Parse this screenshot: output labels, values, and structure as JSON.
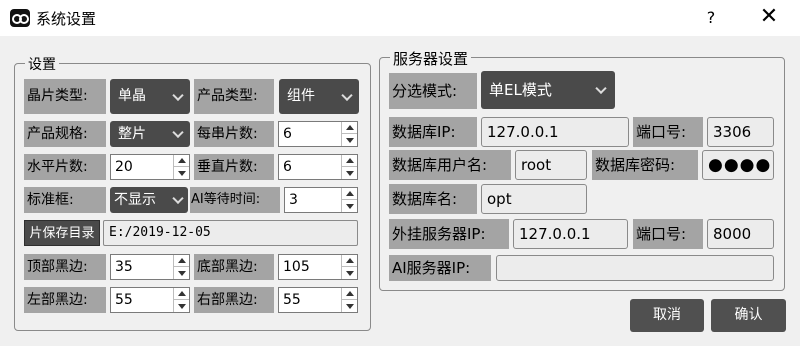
{
  "window": {
    "title": "系统设置",
    "help": "?",
    "close": "✕"
  },
  "settings": {
    "group_title": "设置",
    "wafer_type_label": "晶片类型:",
    "wafer_type_value": "单晶",
    "product_type_label": "产品类型:",
    "product_type_value": "组件",
    "product_spec_label": "产品规格:",
    "product_spec_value": "整片",
    "per_string_label": "每串片数:",
    "per_string_value": "6",
    "horizontal_label": "水平片数:",
    "horizontal_value": "20",
    "vertical_label": "垂直片数:",
    "vertical_value": "6",
    "frame_label": "标准框:",
    "frame_value": "不显示",
    "ai_wait_label": "AI等待时间:",
    "ai_wait_value": "3",
    "save_dir_button": "片保存目录",
    "save_dir_value": "E:/2019-12-05",
    "top_black_label": "顶部黑边:",
    "top_black_value": "35",
    "bottom_black_label": "底部黑边:",
    "bottom_black_value": "105",
    "left_black_label": "左部黑边:",
    "left_black_value": "55",
    "right_black_label": "右部黑边:",
    "right_black_value": "55"
  },
  "server": {
    "group_title": "服务器设置",
    "mode_label": "分选模式:",
    "mode_value": "单EL模式",
    "db_ip_label": "数据库IP:",
    "db_ip_value": "127.0.0.1",
    "db_port_label": "端口号:",
    "db_port_value": "3306",
    "db_user_label": "数据库用户名:",
    "db_user_value": "root",
    "db_pass_label": "数据库密码:",
    "db_pass_value": "●●●●",
    "db_name_label": "数据库名:",
    "db_name_value": "opt",
    "ext_ip_label": "外挂服务器IP:",
    "ext_ip_value": "127.0.0.1",
    "ext_port_label": "端口号:",
    "ext_port_value": "8000",
    "ai_ip_label": "AI服务器IP:",
    "ai_ip_value": ""
  },
  "actions": {
    "cancel": "取消",
    "confirm": "确认"
  },
  "colors": {
    "dark_control": "#4a4a4a",
    "label_bg": "#a4a4a4",
    "window_bg": "#f0f0f0"
  }
}
